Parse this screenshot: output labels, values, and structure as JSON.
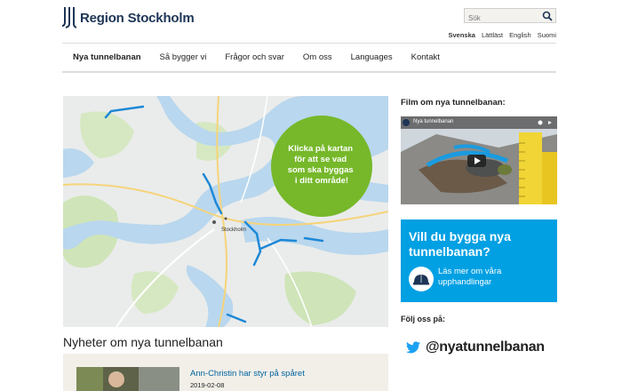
{
  "header": {
    "logo_text": "Region Stockholm",
    "search_placeholder": "Sök",
    "languages": [
      "Svenska",
      "Lättläst",
      "English",
      "Suomi"
    ]
  },
  "nav": {
    "items": [
      "Nya tunnelbanan",
      "Så bygger vi",
      "Frågor och svar",
      "Om oss",
      "Languages",
      "Kontakt"
    ]
  },
  "map": {
    "callout": [
      "Klicka på kartan",
      "för att se vad",
      "som ska byggas",
      "i ditt område!"
    ],
    "labels": [
      "Stockholm"
    ],
    "colors": {
      "water": "#b9d7ee",
      "land": "#eaeceb",
      "park": "#cfe4b8",
      "line": "#1e88d6",
      "callout": "#76b82a"
    }
  },
  "sidebar": {
    "film_title": "Film om nya tunnelbanan:",
    "video_title": "Nya tunnelbanan",
    "promo_title": "Vill du bygga nya tunnelbanan?",
    "promo_link": "Läs mer om våra upphandlingar",
    "follow_title": "Följ oss på:",
    "twitter_handle": "@nyatunnelbanan"
  },
  "news": {
    "section_title": "Nyheter om nya tunnelbanan",
    "items": [
      {
        "headline": "Ann-Christin har styr på spåret",
        "date": "2019-02-08"
      }
    ]
  },
  "colors": {
    "brand_navy": "#1d3556",
    "promo_blue": "#00a0e3",
    "link_blue": "#00639e",
    "twitter_blue": "#1da1f2"
  }
}
